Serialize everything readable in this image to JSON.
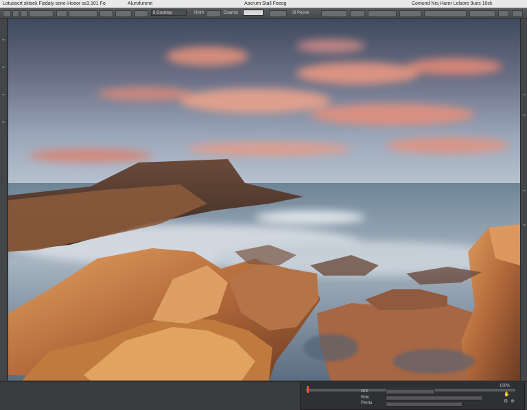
{
  "menubar": {
    "left": "Lotusocrt   sktsek   Fizdaly   sone-Hoeor   ss3.101   Fo",
    "middle": "Alurofuremt",
    "center": "Aocrum   Stall Foeog",
    "right": "Comund Nrs Harer   Lelsore   9ues   10ck"
  },
  "toolbar": {
    "field_1": "6 Gosrtiep",
    "label_2": "Hnlm",
    "label_3": "Doamol",
    "field_4": "",
    "label_5": "Sl   Peone"
  },
  "timeline": {
    "row_1": "Ortr",
    "row_2": "Rnlu",
    "row_3": "Perrtu",
    "row_4": "100%"
  },
  "colors": {
    "accent": "#d9563a",
    "panel": "#3a3b3d",
    "menubar": "#e9e9ea"
  },
  "icons": [
    "hand-icon",
    "zoom-icon",
    "settings-icon"
  ]
}
